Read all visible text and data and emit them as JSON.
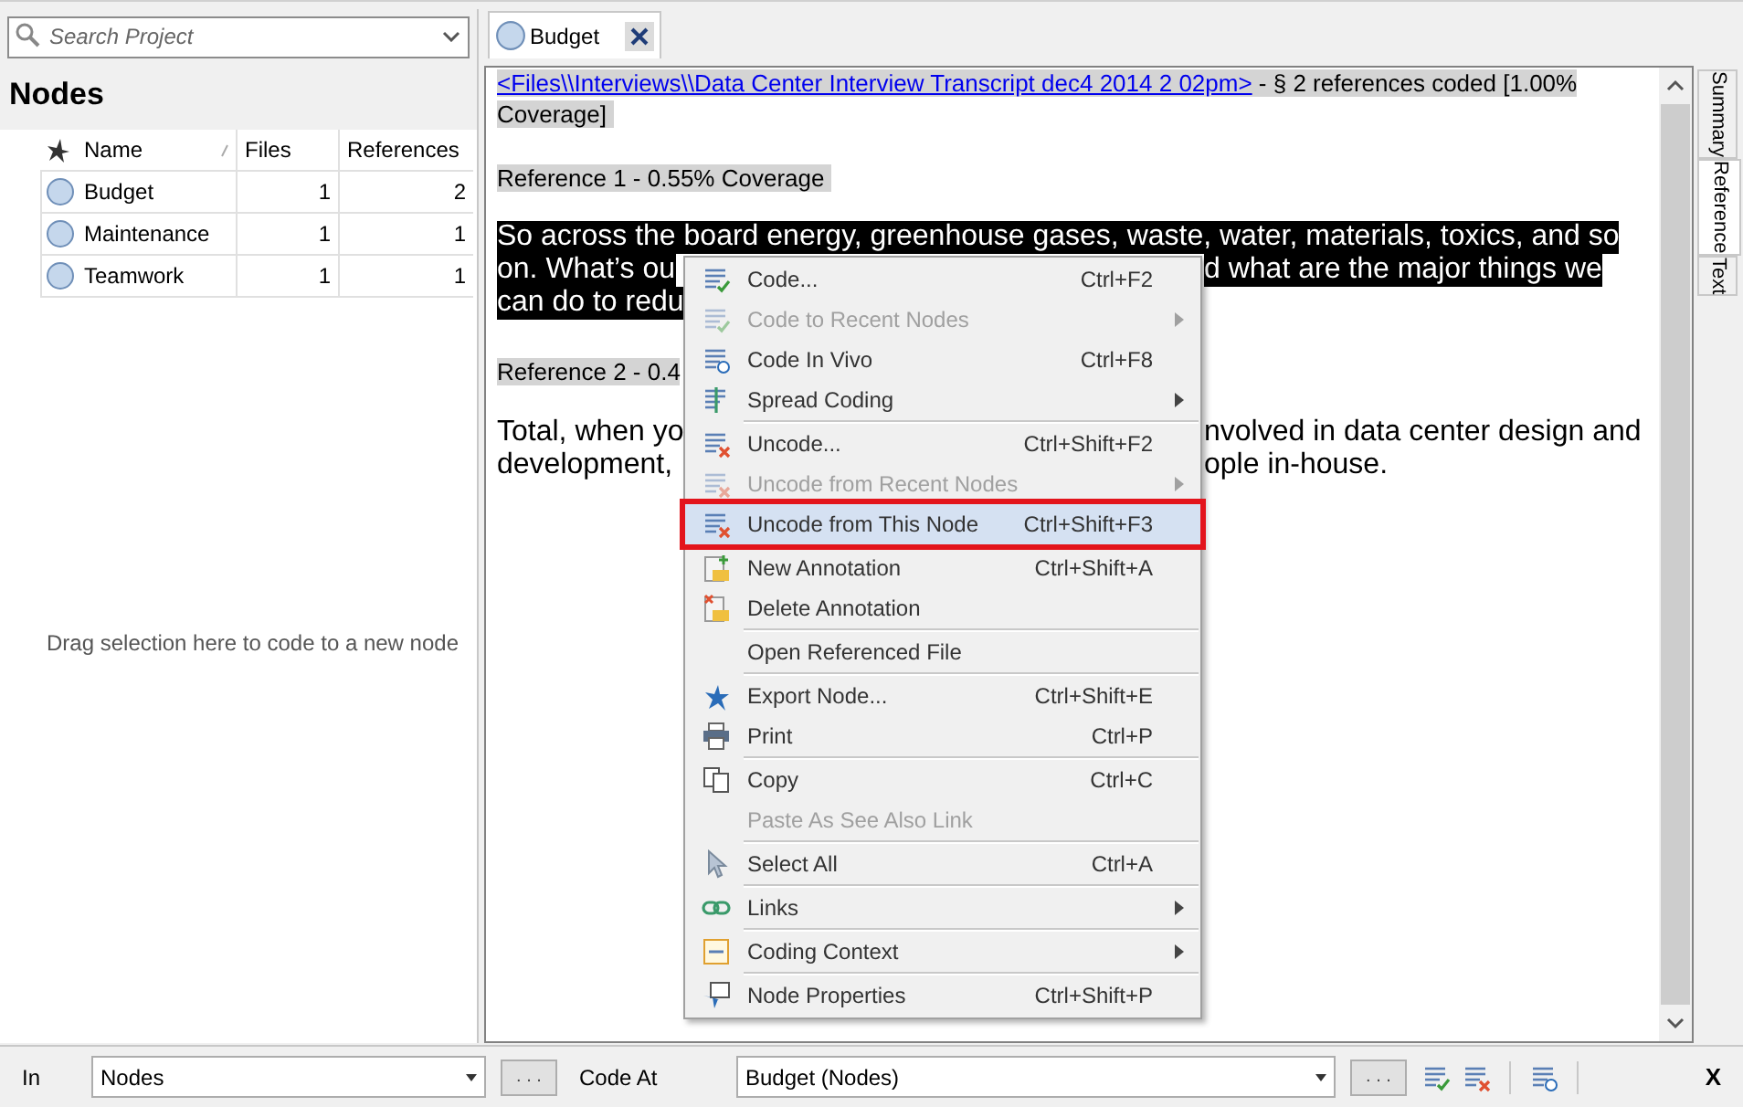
{
  "sidebar": {
    "search": {
      "placeholder": "Search Project"
    },
    "title": "Nodes",
    "columns": [
      "Name",
      "Files",
      "References"
    ],
    "rows": [
      {
        "name": "Budget",
        "files": "1",
        "references": "2"
      },
      {
        "name": "Maintenance",
        "files": "1",
        "references": "1"
      },
      {
        "name": "Teamwork",
        "files": "1",
        "references": "1"
      }
    ],
    "drop_hint": "Drag selection here to code to a new node"
  },
  "tab": {
    "label": "Budget",
    "selected": true
  },
  "document": {
    "header_link": "<Files\\\\Interviews\\\\Data Center Interview Transcript dec4 2014 2 02pm>",
    "header_rest": " - § 2 references coded  [1.00%",
    "header_line2": "Coverage] ",
    "reference1": "Reference 1 - 0.55% Coverage ",
    "paragraph1": [
      {
        "left": "So across the board energy, greenhouse gases, waste, water, materials, toxics, and so"
      },
      {
        "left": "on. What’s ou",
        "right": "d what are the major things we"
      },
      {
        "left": "can do to redu"
      }
    ],
    "reference2": "Reference 2 - 0.4",
    "paragraph2": [
      {
        "left": "Total, when yo",
        "right": "nvolved in data center design and"
      },
      {
        "left": "development,",
        "right": "ople in-house."
      }
    ]
  },
  "side_tabs": [
    {
      "label": "Summary",
      "selected": false
    },
    {
      "label": "Reference",
      "selected": true
    },
    {
      "label": "Text",
      "selected": false
    }
  ],
  "context_menu": [
    [
      {
        "label": "Code...",
        "shortcut": "Ctrl+F2",
        "disabled": false,
        "submenu": false,
        "selected": false
      },
      {
        "label": "Code to Recent Nodes",
        "disabled": true,
        "submenu": true,
        "selected": false
      },
      {
        "label": "Code In Vivo",
        "shortcut": "Ctrl+F8",
        "disabled": false,
        "submenu": false,
        "selected": false
      },
      {
        "label": "Spread Coding",
        "disabled": false,
        "submenu": true,
        "selected": false
      }
    ],
    [
      {
        "label": "Uncode...",
        "shortcut": "Ctrl+Shift+F2",
        "disabled": false,
        "submenu": false,
        "selected": false
      },
      {
        "label": "Uncode from Recent Nodes",
        "disabled": true,
        "submenu": true,
        "selected": false
      },
      {
        "label": "Uncode from This Node",
        "shortcut": "Ctrl+Shift+F3",
        "disabled": false,
        "submenu": false,
        "selected": true
      }
    ],
    [
      {
        "label": "New Annotation",
        "shortcut": "Ctrl+Shift+A",
        "disabled": false,
        "submenu": false,
        "selected": false
      },
      {
        "label": "Delete Annotation",
        "disabled": false,
        "submenu": false,
        "selected": false
      }
    ],
    [
      {
        "label": "Open Referenced File",
        "disabled": false,
        "submenu": false,
        "selected": false
      }
    ],
    [
      {
        "label": "Export Node...",
        "shortcut": "Ctrl+Shift+E",
        "disabled": false,
        "submenu": false,
        "selected": false
      },
      {
        "label": "Print",
        "shortcut": "Ctrl+P",
        "disabled": false,
        "submenu": false,
        "selected": false
      }
    ],
    [
      {
        "label": "Copy",
        "shortcut": "Ctrl+C",
        "disabled": false,
        "submenu": false,
        "selected": false
      },
      {
        "label": "Paste As See Also Link",
        "disabled": true,
        "submenu": false,
        "selected": false
      }
    ],
    [
      {
        "label": "Select All",
        "shortcut": "Ctrl+A",
        "disabled": false,
        "submenu": false,
        "selected": false
      }
    ],
    [
      {
        "label": "Links",
        "disabled": false,
        "submenu": true,
        "selected": false
      }
    ],
    [
      {
        "label": "Coding Context",
        "disabled": false,
        "submenu": true,
        "selected": false
      }
    ],
    [
      {
        "label": "Node Properties",
        "shortcut": "Ctrl+Shift+P",
        "disabled": false,
        "submenu": false,
        "selected": false
      }
    ]
  ],
  "bottom_bar": {
    "in_label": "In",
    "in_value": "Nodes",
    "browse1": ". . .",
    "code_at_label": "Code At",
    "code_at_value": "Budget (Nodes)",
    "browse2": ". . .",
    "close": "X"
  }
}
